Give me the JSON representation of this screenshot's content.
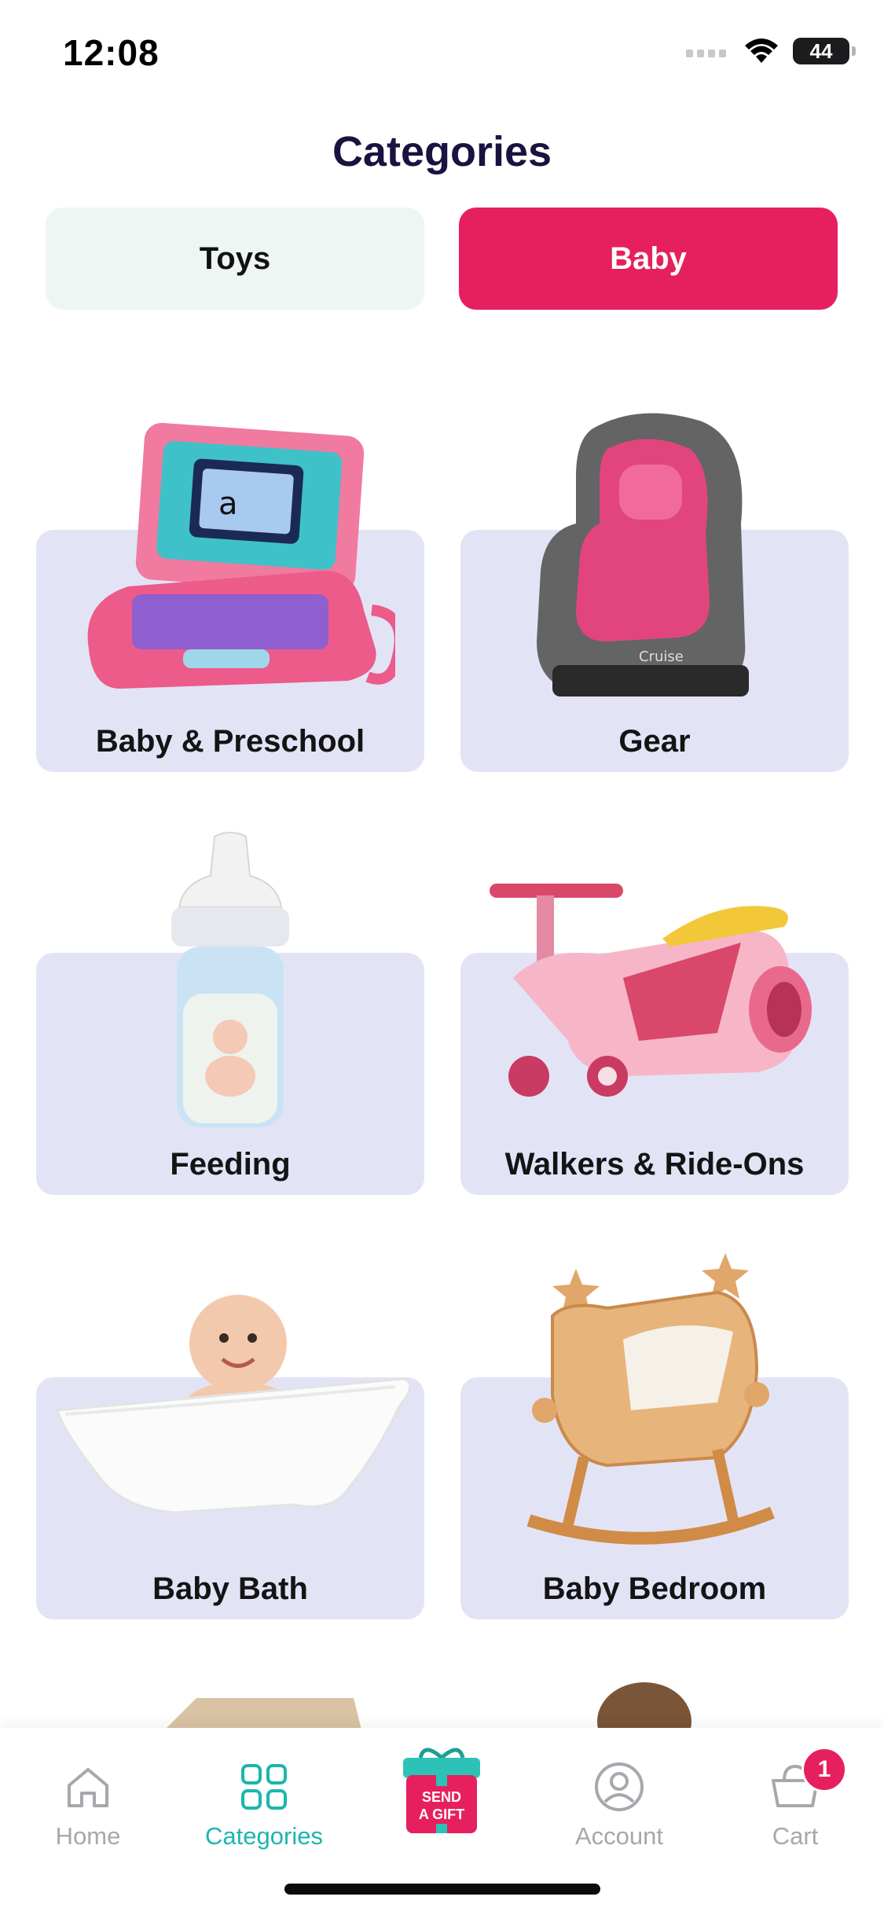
{
  "status_bar": {
    "time": "12:08",
    "battery": "44"
  },
  "page_title": "Categories",
  "tabs": [
    {
      "label": "Toys",
      "active": false
    },
    {
      "label": "Baby",
      "active": true
    }
  ],
  "categories": [
    {
      "label": "Baby & Preschool",
      "icon": "toy-laptop-image"
    },
    {
      "label": "Gear",
      "icon": "car-seat-image"
    },
    {
      "label": "Feeding",
      "icon": "baby-bottle-image"
    },
    {
      "label": "Walkers & Ride-Ons",
      "icon": "ride-on-toy-image"
    },
    {
      "label": "Baby Bath",
      "icon": "baby-bathtub-image"
    },
    {
      "label": "Baby Bedroom",
      "icon": "baby-cradle-image"
    }
  ],
  "bottom_nav": {
    "items": [
      {
        "label": "Home",
        "icon": "home-icon"
      },
      {
        "label": "Categories",
        "icon": "grid-icon",
        "active": true
      },
      {
        "label": "Account",
        "icon": "account-icon"
      },
      {
        "label": "Cart",
        "icon": "cart-icon"
      }
    ],
    "gift_button": {
      "line1": "SEND",
      "line2": "A GIFT"
    },
    "cart_badge": "1"
  },
  "colors": {
    "accent_pink": "#e6205e",
    "accent_teal": "#1bb6ad",
    "card_bg": "#e2e4f6",
    "toys_tab_bg": "#eef6f4"
  }
}
